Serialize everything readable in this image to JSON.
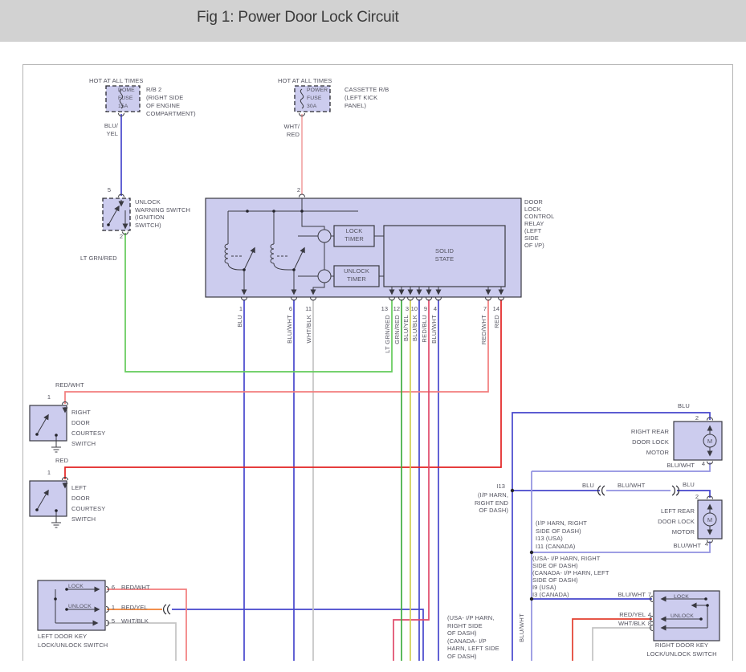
{
  "header": {
    "title": "Fig 1: Power Door Lock Circuit"
  },
  "colors": {
    "box_fill": "#ccccee",
    "outline": "#3a3a42",
    "blu": "#4646cc",
    "blu_wht_light": "#9191e0",
    "wht_blk": "#c4c4c4",
    "wht_red": "#f2a6a6",
    "red": "#e32222",
    "red_wht": "#f27d7d",
    "red_blu": "#e04a6a",
    "red_yel": "#f08032",
    "red_yel_right": "#e33e2e",
    "lt_grn_red": "#63cb5a",
    "grn_red": "#3fae3f",
    "blu_yel": "#cfcf52"
  },
  "fuse_dome": {
    "hot": "HOT AT ALL TIMES",
    "name": "DOME\nFUSE\n15A",
    "location": "R/B 2\n(RIGHT SIDE\nOF ENGINE\nCOMPARTMENT)",
    "wire": "BLU/\nYEL"
  },
  "fuse_power": {
    "hot": "HOT AT ALL TIMES",
    "name": "POWER\nFUSE\n30A",
    "location": "CASSETTE R/B\n(LEFT KICK\nPANEL)",
    "wire": "WHT/\nRED"
  },
  "ignition_switch": {
    "pin_in": "5",
    "pin_out": "2",
    "label": "UNLOCK\nWARNING SWITCH\n(IGNITION\nSWITCH)",
    "wire_out": "LT GRN/RED"
  },
  "relay": {
    "pin_in": "2",
    "label": "DOOR\nLOCK\nCONTROL\nRELAY\n(LEFT\nSIDE\nOF I/P)",
    "lock_timer": "LOCK\nTIMER",
    "unlock_timer": "UNLOCK\nTIMER",
    "solid_state": "SOLID\nSTATE",
    "pins": [
      {
        "n": "1",
        "wire": "BLU"
      },
      {
        "n": "6",
        "wire": "BLU/WHT"
      },
      {
        "n": "11",
        "wire": "WHT/BLK"
      },
      {
        "n": "13",
        "wire": "LT GRN/RED"
      },
      {
        "n": "12",
        "wire": "GRN/RED"
      },
      {
        "n": "3",
        "wire": "BLU/YEL"
      },
      {
        "n": "10",
        "wire": "BLU/BLK"
      },
      {
        "n": "9",
        "wire": "RED/BLU"
      },
      {
        "n": "4",
        "wire": "BLU/WHT"
      },
      {
        "n": "7",
        "wire": "RED/WHT"
      },
      {
        "n": "14",
        "wire": "RED"
      }
    ]
  },
  "right_courtesy": {
    "wire": "RED/WHT",
    "pin": "1",
    "label": "RIGHT\nDOOR\nCOURTESY\nSWITCH"
  },
  "left_courtesy": {
    "wire": "RED",
    "pin": "1",
    "label": "LEFT\nDOOR\nCOURTESY\nSWITCH"
  },
  "left_key": {
    "lock": "LOCK",
    "unlock": "UNLOCK",
    "pins": [
      {
        "n": "6",
        "wire": "RED/WHT"
      },
      {
        "n": "1",
        "wire": "RED/YEL"
      },
      {
        "n": "5",
        "wire": "WHT/BLK"
      }
    ],
    "label": "LEFT DOOR KEY\nLOCK/UNLOCK SWITCH"
  },
  "right_key": {
    "lock": "LOCK",
    "unlock": "UNLOCK",
    "pins": [
      {
        "wire": "BLU/WHT",
        "n": "7"
      },
      {
        "wire": "RED/YEL",
        "n": "4"
      },
      {
        "wire": "WHT/BLK",
        "n": "8"
      }
    ],
    "label": "RIGHT DOOR KEY\nLOCK/UNLOCK SWITCH"
  },
  "right_rear_motor": {
    "wire_in": "BLU",
    "pin_in": "2",
    "m": "M",
    "label": "RIGHT REAR\nDOOR LOCK\nMOTOR",
    "wire_out": "BLU/WHT",
    "pin_out": "4"
  },
  "left_rear_motor": {
    "wire_in": "BLU",
    "pin_in": "2",
    "m": "M",
    "label": "LEFT REAR\nDOOR LOCK\nMOTOR",
    "wire_out": "BLU/WHT",
    "pin_out": "4"
  },
  "junctions": {
    "i13": "I13",
    "i13_loc": "(I/P HARN,\nRIGHT END\nOF DASH)",
    "seg_left": "BLU",
    "seg_mid": "BLU/WHT",
    "seg_right": "BLU",
    "harness_mid": "(I/P HARN, RIGHT\nSIDE OF DASH)\nI13 (USA)\nI11 (CANADA)",
    "harness_low": "(USA- I/P HARN, RIGHT\nSIDE OF DASH)\n(CANADA- I/P HARN, LEFT\nSIDE OF DASH)\nI9 (USA)\nI3 (CANADA)",
    "harness_bottom": "(USA- I/P HARN,\nRIGHT SIDE\nOF DASH)\n(CANADA- I/P\nHARN, LEFT SIDE\nOF DASH)",
    "trunk": "BLU/WHT"
  }
}
